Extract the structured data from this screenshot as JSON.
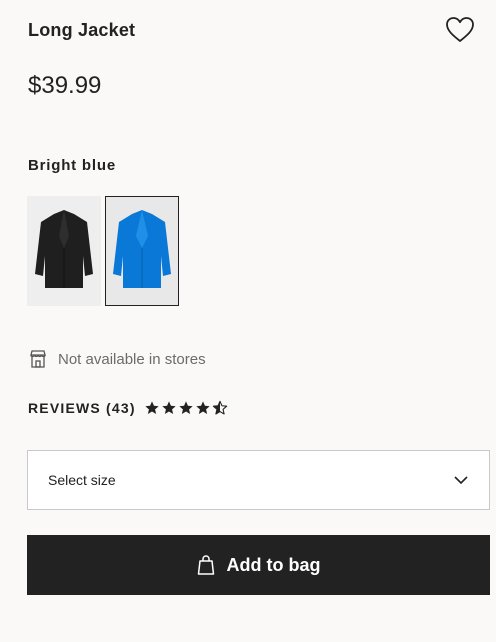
{
  "product": {
    "title": "Long Jacket",
    "price": "$39.99",
    "color_label": "Bright blue",
    "favorite_icon": "heart-outline-icon"
  },
  "swatches": [
    {
      "color": "black",
      "hex": "#1f1f1f",
      "selected": false
    },
    {
      "color": "Bright blue",
      "hex": "#0a78d6",
      "selected": true
    }
  ],
  "store": {
    "icon": "store-icon",
    "text": "Not available in stores"
  },
  "reviews": {
    "label": "REVIEWS (43)",
    "rating": 4.5,
    "max": 5
  },
  "size": {
    "placeholder": "Select size",
    "icon": "chevron-down-icon"
  },
  "cart": {
    "label": "Add to bag",
    "icon": "shopping-bag-icon"
  }
}
